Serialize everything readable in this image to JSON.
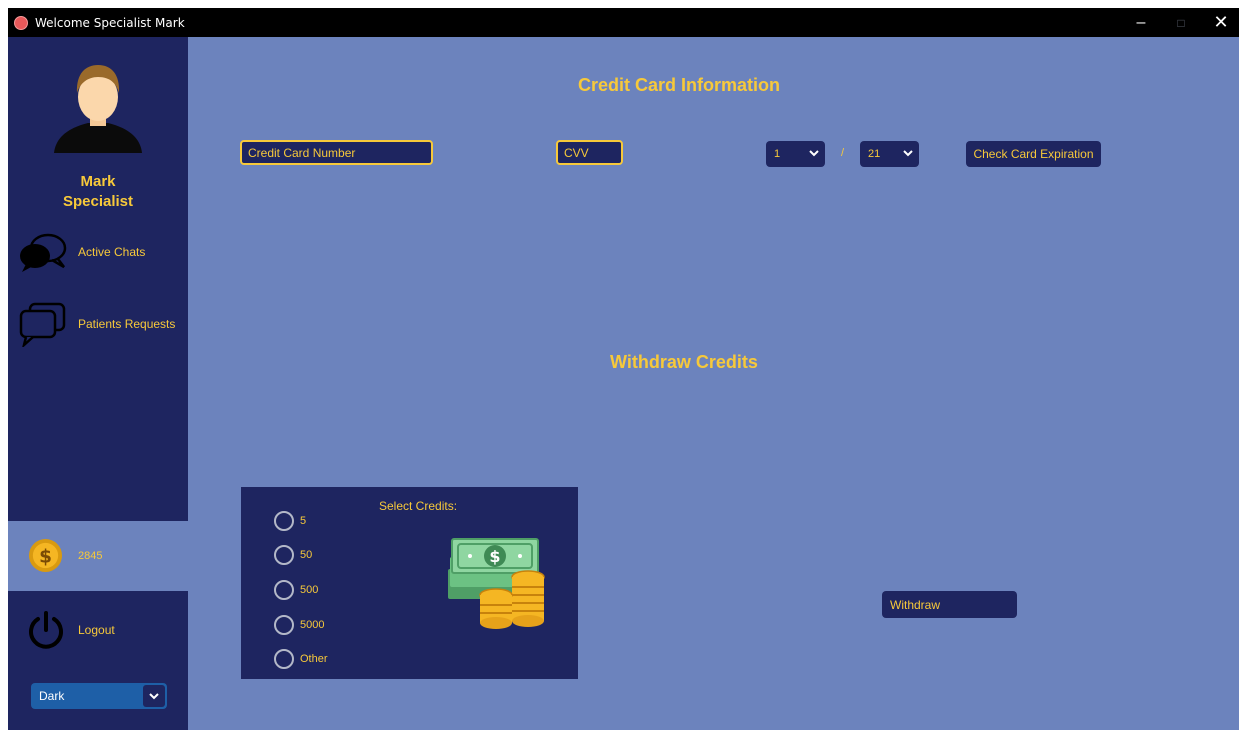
{
  "window": {
    "title": "Welcome Specialist Mark",
    "controls": {
      "minimize": "–",
      "maximize": "□",
      "close": "✕"
    }
  },
  "sidebar": {
    "profile": {
      "first_name": "Mark",
      "role": "Specialist",
      "avatar_icon": "user-avatar-icon"
    },
    "items": [
      {
        "label": "Active Chats",
        "icon": "chat-bubbles-icon"
      },
      {
        "label": "Patients Requests",
        "icon": "message-boxes-icon"
      }
    ],
    "credits": {
      "value": "2845",
      "icon": "coin-icon"
    },
    "logout": {
      "label": "Logout",
      "icon": "power-icon"
    },
    "theme": {
      "selected": "Dark"
    }
  },
  "card": {
    "heading": "Credit Card Information",
    "number_placeholder": "Credit Card Number",
    "cvv_placeholder": "CVV",
    "month": "1",
    "separator": "/",
    "year": "21",
    "check_button": "Check Card Expiration"
  },
  "withdraw": {
    "heading": "Withdraw Credits",
    "select_label": "Select Credits:",
    "options": [
      "5",
      "50",
      "500",
      "5000",
      "Other"
    ],
    "button": "Withdraw",
    "art_icon": "money-coins-icon"
  },
  "colors": {
    "background": "#6c83bd",
    "sidebar": "#1e2560",
    "accent": "#f7c93a",
    "titlebar": "#000000"
  }
}
